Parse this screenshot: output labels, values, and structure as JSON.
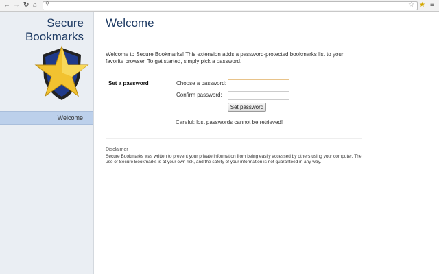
{
  "browser": {
    "icons": [
      "back-icon",
      "forward-icon",
      "reload-icon",
      "home-icon",
      "search-icon",
      "star-icon",
      "extension-icon",
      "menu-icon"
    ]
  },
  "sidebar": {
    "brand_line1": "Secure",
    "brand_line2": "Bookmarks",
    "items": [
      {
        "label": "Welcome"
      }
    ]
  },
  "main": {
    "title": "Welcome",
    "intro": "Welcome to Secure Bookmarks! This extension adds a password-protected bookmarks list to your favorite browser. To get started, simply pick a password.",
    "section_title": "Set a password",
    "choose_label": "Choose a password:",
    "confirm_label": "Confirm password:",
    "set_button": "Set password",
    "warning": "Careful: lost passwords cannot be retrieved!",
    "disclaimer_title": "Disclaimer",
    "disclaimer": "Secure Bookmarks was written to prevent your private information from being easily accessed by others using your computer. The use of Secure Bookmarks is at your own risk, and the safety of your information is not guaranteed in any way."
  }
}
